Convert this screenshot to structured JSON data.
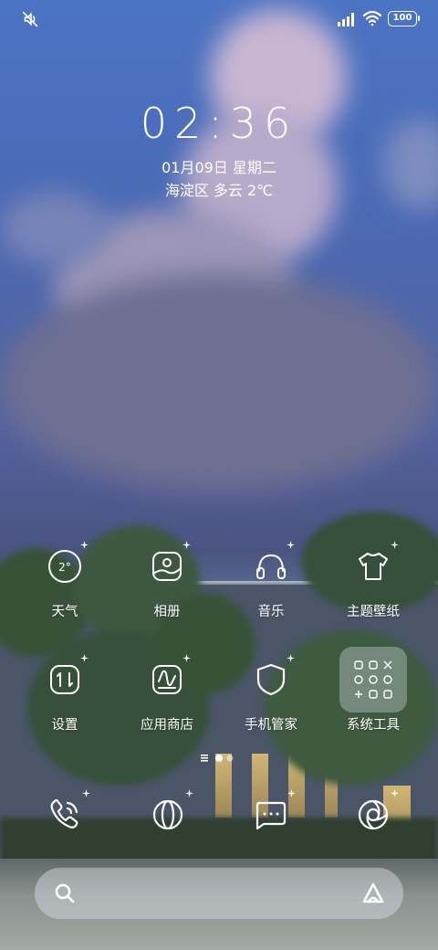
{
  "status_bar": {
    "battery_level": "100",
    "icons": [
      "mute-icon",
      "signal-icon",
      "wifi-icon",
      "battery-icon"
    ]
  },
  "lock_clock": {
    "time": "02:36",
    "date": "01月09日 星期二",
    "weather": "海淀区 多云 2℃"
  },
  "apps": [
    {
      "label": "天气",
      "icon": "weather-icon",
      "icon_text": "2°"
    },
    {
      "label": "相册",
      "icon": "gallery-icon"
    },
    {
      "label": "音乐",
      "icon": "music-icon"
    },
    {
      "label": "主题壁纸",
      "icon": "theme-icon"
    },
    {
      "label": "设置",
      "icon": "settings-icon"
    },
    {
      "label": "应用商店",
      "icon": "app-store-icon"
    },
    {
      "label": "手机管家",
      "icon": "security-icon"
    },
    {
      "label": "系统工具",
      "icon": "system-tools-folder-icon"
    }
  ],
  "dock": [
    {
      "icon": "phone-icon"
    },
    {
      "icon": "browser-icon"
    },
    {
      "icon": "messages-icon"
    },
    {
      "icon": "camera-icon"
    }
  ],
  "page_indicator": {
    "current": 1,
    "pages": 2
  },
  "colors": {
    "text": "#ffffff",
    "searchbar": "#dce1e8"
  }
}
